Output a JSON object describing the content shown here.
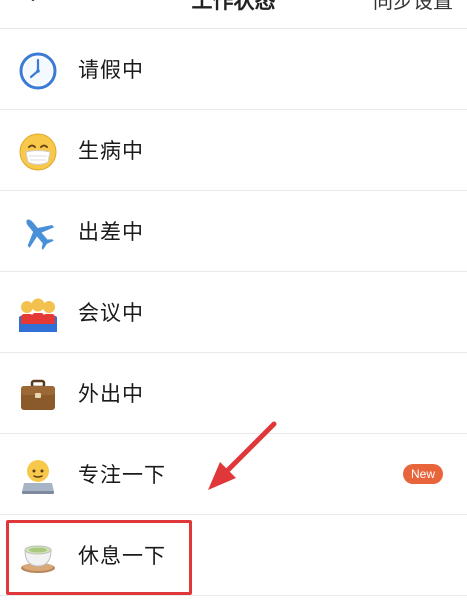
{
  "header": {
    "title": "工作状态",
    "action_label": "同步设置",
    "back_icon": "chevron-down-icon"
  },
  "status_list": [
    {
      "label": "请假中",
      "icon": "clock-icon"
    },
    {
      "label": "生病中",
      "icon": "mask-face-icon"
    },
    {
      "label": "出差中",
      "icon": "airplane-icon"
    },
    {
      "label": "会议中",
      "icon": "meeting-people-icon"
    },
    {
      "label": "外出中",
      "icon": "briefcase-icon"
    },
    {
      "label": "专注一下",
      "icon": "person-laptop-icon",
      "badge": "New"
    },
    {
      "label": "休息一下",
      "icon": "tea-cup-icon"
    }
  ],
  "colors": {
    "badge": "#e8643b",
    "annotation": "#e0383a"
  }
}
